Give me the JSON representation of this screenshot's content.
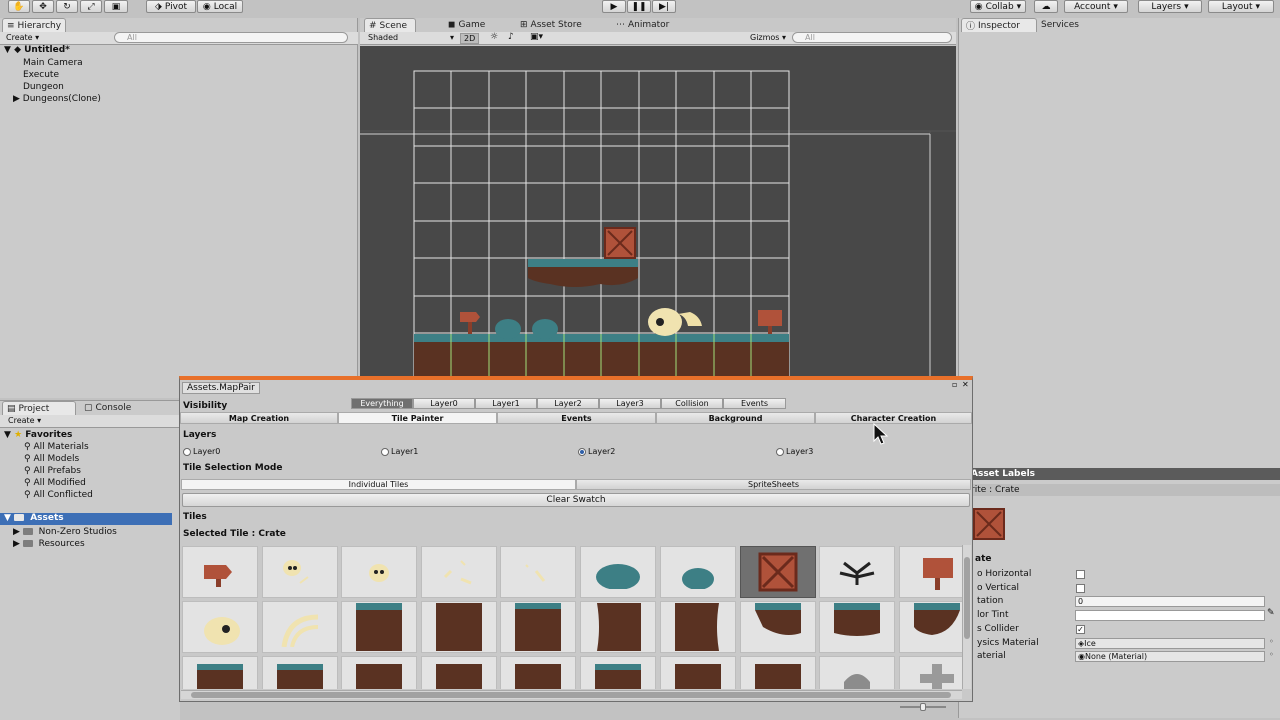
{
  "toolbar": {
    "pivot": "Pivot",
    "local": "Local",
    "collab": "Collab",
    "account": "Account",
    "layers": "Layers",
    "layout": "Layout"
  },
  "hierarchy": {
    "tab": "Hierarchy",
    "create": "Create",
    "search_placeholder": "All",
    "scene": "Untitled*",
    "items": [
      "Main Camera",
      "Execute",
      "Dungeon",
      "Dungeons(Clone)"
    ]
  },
  "scene_view": {
    "tabs": [
      "Scene",
      "Game",
      "Asset Store",
      "Animator"
    ],
    "shading": "Shaded",
    "mode_2d": "2D",
    "gizmos": "Gizmos",
    "search_placeholder": "All"
  },
  "inspector": {
    "tabs": [
      "Inspector",
      "Services"
    ],
    "asset_labels": "Asset Labels",
    "sprite_header": "rite : Crate",
    "crate_title": "ate",
    "fields": [
      {
        "label": "o Horizontal",
        "kind": "checkbox",
        "value": ""
      },
      {
        "label": "o Vertical",
        "kind": "checkbox",
        "value": ""
      },
      {
        "label": "tation",
        "kind": "text",
        "value": "0"
      },
      {
        "label": "lor Tint",
        "kind": "color",
        "value": ""
      },
      {
        "label": "s Collider",
        "kind": "checkbox",
        "value": "✓"
      },
      {
        "label": "ysics Material",
        "kind": "object",
        "value": "Ice"
      },
      {
        "label": "aterial",
        "kind": "object",
        "value": "None (Material)"
      }
    ]
  },
  "project": {
    "tabs": [
      "Project",
      "Console"
    ],
    "create": "Create",
    "favorites_label": "Favorites",
    "favorites": [
      "All Materials",
      "All Models",
      "All Prefabs",
      "All Modified",
      "All Conflicted"
    ],
    "assets_label": "Assets",
    "folders": [
      "Non-Zero Studios",
      "Resources"
    ]
  },
  "mappair": {
    "title": "Assets.MapPair",
    "visibility_label": "Visibility",
    "visibility_tabs": [
      "Everything",
      "Layer0",
      "Layer1",
      "Layer2",
      "Layer3",
      "Collision",
      "Events"
    ],
    "mode_tabs": [
      "Map Creation",
      "Tile Painter",
      "Events",
      "Background",
      "Character Creation"
    ],
    "layers_label": "Layers",
    "layers": [
      "Layer0",
      "Layer1",
      "Layer2",
      "Layer3"
    ],
    "selected_layer": "Layer2",
    "tile_mode_label": "Tile Selection Mode",
    "tile_modes": [
      "Individual Tiles",
      "SpriteSheets"
    ],
    "clear_swatch": "Clear Swatch",
    "tiles_label": "Tiles",
    "selected_tile": "Selected Tile : Crate"
  },
  "colors": {
    "accent": "#e8702a",
    "scene_bg": "#484848",
    "grass": "#3d7f85",
    "dirt": "#5a3222",
    "crate": "#b0523a"
  }
}
